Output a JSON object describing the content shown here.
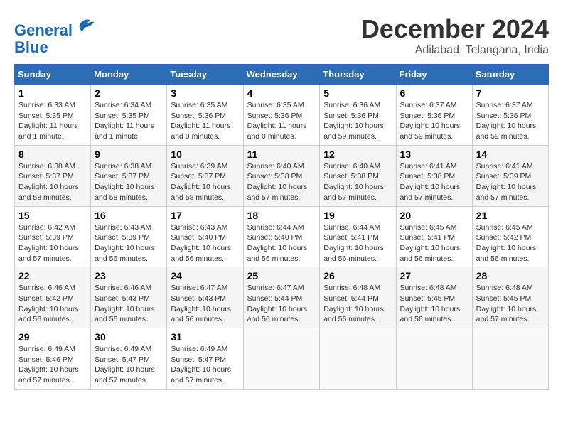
{
  "header": {
    "logo_line1": "General",
    "logo_line2": "Blue",
    "month": "December 2024",
    "location": "Adilabad, Telangana, India"
  },
  "days_of_week": [
    "Sunday",
    "Monday",
    "Tuesday",
    "Wednesday",
    "Thursday",
    "Friday",
    "Saturday"
  ],
  "weeks": [
    [
      {
        "day": "1",
        "info": "Sunrise: 6:33 AM\nSunset: 5:35 PM\nDaylight: 11 hours and 1 minute."
      },
      {
        "day": "2",
        "info": "Sunrise: 6:34 AM\nSunset: 5:35 PM\nDaylight: 11 hours and 1 minute."
      },
      {
        "day": "3",
        "info": "Sunrise: 6:35 AM\nSunset: 5:36 PM\nDaylight: 11 hours and 0 minutes."
      },
      {
        "day": "4",
        "info": "Sunrise: 6:35 AM\nSunset: 5:36 PM\nDaylight: 11 hours and 0 minutes."
      },
      {
        "day": "5",
        "info": "Sunrise: 6:36 AM\nSunset: 5:36 PM\nDaylight: 10 hours and 59 minutes."
      },
      {
        "day": "6",
        "info": "Sunrise: 6:37 AM\nSunset: 5:36 PM\nDaylight: 10 hours and 59 minutes."
      },
      {
        "day": "7",
        "info": "Sunrise: 6:37 AM\nSunset: 5:36 PM\nDaylight: 10 hours and 59 minutes."
      }
    ],
    [
      {
        "day": "8",
        "info": "Sunrise: 6:38 AM\nSunset: 5:37 PM\nDaylight: 10 hours and 58 minutes."
      },
      {
        "day": "9",
        "info": "Sunrise: 6:38 AM\nSunset: 5:37 PM\nDaylight: 10 hours and 58 minutes."
      },
      {
        "day": "10",
        "info": "Sunrise: 6:39 AM\nSunset: 5:37 PM\nDaylight: 10 hours and 58 minutes."
      },
      {
        "day": "11",
        "info": "Sunrise: 6:40 AM\nSunset: 5:38 PM\nDaylight: 10 hours and 57 minutes."
      },
      {
        "day": "12",
        "info": "Sunrise: 6:40 AM\nSunset: 5:38 PM\nDaylight: 10 hours and 57 minutes."
      },
      {
        "day": "13",
        "info": "Sunrise: 6:41 AM\nSunset: 5:38 PM\nDaylight: 10 hours and 57 minutes."
      },
      {
        "day": "14",
        "info": "Sunrise: 6:41 AM\nSunset: 5:39 PM\nDaylight: 10 hours and 57 minutes."
      }
    ],
    [
      {
        "day": "15",
        "info": "Sunrise: 6:42 AM\nSunset: 5:39 PM\nDaylight: 10 hours and 57 minutes."
      },
      {
        "day": "16",
        "info": "Sunrise: 6:43 AM\nSunset: 5:39 PM\nDaylight: 10 hours and 56 minutes."
      },
      {
        "day": "17",
        "info": "Sunrise: 6:43 AM\nSunset: 5:40 PM\nDaylight: 10 hours and 56 minutes."
      },
      {
        "day": "18",
        "info": "Sunrise: 6:44 AM\nSunset: 5:40 PM\nDaylight: 10 hours and 56 minutes."
      },
      {
        "day": "19",
        "info": "Sunrise: 6:44 AM\nSunset: 5:41 PM\nDaylight: 10 hours and 56 minutes."
      },
      {
        "day": "20",
        "info": "Sunrise: 6:45 AM\nSunset: 5:41 PM\nDaylight: 10 hours and 56 minutes."
      },
      {
        "day": "21",
        "info": "Sunrise: 6:45 AM\nSunset: 5:42 PM\nDaylight: 10 hours and 56 minutes."
      }
    ],
    [
      {
        "day": "22",
        "info": "Sunrise: 6:46 AM\nSunset: 5:42 PM\nDaylight: 10 hours and 56 minutes."
      },
      {
        "day": "23",
        "info": "Sunrise: 6:46 AM\nSunset: 5:43 PM\nDaylight: 10 hours and 56 minutes."
      },
      {
        "day": "24",
        "info": "Sunrise: 6:47 AM\nSunset: 5:43 PM\nDaylight: 10 hours and 56 minutes."
      },
      {
        "day": "25",
        "info": "Sunrise: 6:47 AM\nSunset: 5:44 PM\nDaylight: 10 hours and 56 minutes."
      },
      {
        "day": "26",
        "info": "Sunrise: 6:48 AM\nSunset: 5:44 PM\nDaylight: 10 hours and 56 minutes."
      },
      {
        "day": "27",
        "info": "Sunrise: 6:48 AM\nSunset: 5:45 PM\nDaylight: 10 hours and 56 minutes."
      },
      {
        "day": "28",
        "info": "Sunrise: 6:48 AM\nSunset: 5:45 PM\nDaylight: 10 hours and 57 minutes."
      }
    ],
    [
      {
        "day": "29",
        "info": "Sunrise: 6:49 AM\nSunset: 5:46 PM\nDaylight: 10 hours and 57 minutes."
      },
      {
        "day": "30",
        "info": "Sunrise: 6:49 AM\nSunset: 5:47 PM\nDaylight: 10 hours and 57 minutes."
      },
      {
        "day": "31",
        "info": "Sunrise: 6:49 AM\nSunset: 5:47 PM\nDaylight: 10 hours and 57 minutes."
      },
      {
        "day": "",
        "info": ""
      },
      {
        "day": "",
        "info": ""
      },
      {
        "day": "",
        "info": ""
      },
      {
        "day": "",
        "info": ""
      }
    ]
  ]
}
